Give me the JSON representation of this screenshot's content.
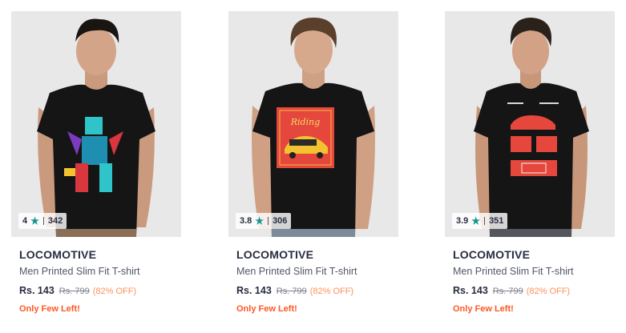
{
  "products": [
    {
      "brand": "LOCOMOTIVE",
      "name": "Men Printed Slim Fit T-shirt",
      "price": "Rs. 143",
      "mrp": "Rs. 799",
      "discount": "(82% OFF)",
      "stock": "Only Few Left!",
      "rating": "4",
      "rating_count": "342",
      "image": "model-in-black-robot-print-tshirt"
    },
    {
      "brand": "LOCOMOTIVE",
      "name": "Men Printed Slim Fit T-shirt",
      "price": "Rs. 143",
      "mrp": "Rs. 799",
      "discount": "(82% OFF)",
      "stock": "Only Few Left!",
      "rating": "3.8",
      "rating_count": "306",
      "image": "model-in-black-car-poster-tshirt",
      "print_text": "Riding"
    },
    {
      "brand": "LOCOMOTIVE",
      "name": "Men Printed Slim Fit T-shirt",
      "price": "Rs. 143",
      "mrp": "Rs. 799",
      "discount": "(82% OFF)",
      "stock": "Only Few Left!",
      "rating": "3.9",
      "rating_count": "351",
      "image": "model-in-black-car-blueprint-tshirt"
    }
  ],
  "icons": {
    "rating": "star-icon"
  },
  "colors": {
    "star": "#14958f",
    "discount": "#ff905a",
    "stock_warning": "#ff5722",
    "image_bg": "#e8e8e9",
    "tshirt": "#151515"
  }
}
